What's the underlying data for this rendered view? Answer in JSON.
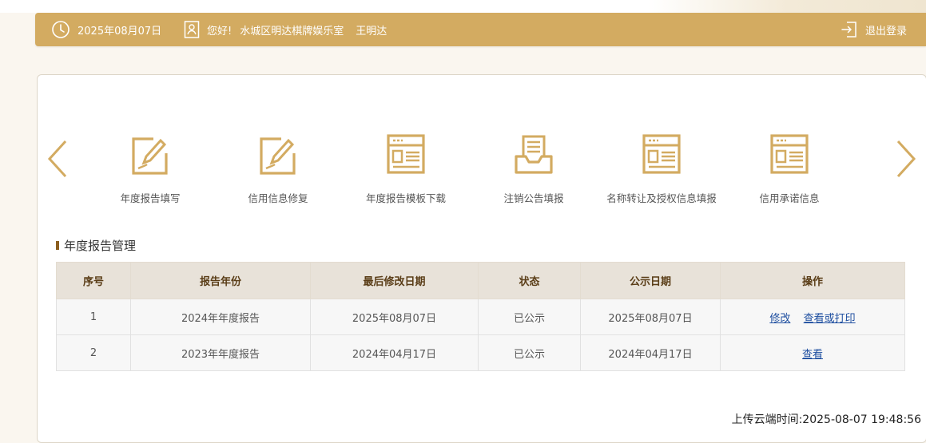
{
  "header": {
    "date": "2025年08月07日",
    "greeting": "您好!",
    "org_name": "水城区明达棋牌娱乐室",
    "user_name": "王明达",
    "logout_label": "退出登录"
  },
  "nav": {
    "items": [
      {
        "label": "年度报告填写",
        "icon": "edit-form-icon"
      },
      {
        "label": "信用信息修复",
        "icon": "edit-form-icon"
      },
      {
        "label": "年度报告模板下载",
        "icon": "document-template-icon"
      },
      {
        "label": "注销公告填报",
        "icon": "inbox-document-icon"
      },
      {
        "label": "名称转让及授权信息填报",
        "icon": "document-template-icon"
      },
      {
        "label": "信用承诺信息",
        "icon": "document-template-icon"
      }
    ]
  },
  "section": {
    "title": "年度报告管理"
  },
  "table": {
    "headers": [
      "序号",
      "报告年份",
      "最后修改日期",
      "状态",
      "公示日期",
      "操作"
    ],
    "rows": [
      {
        "index": "1",
        "year": "2024年年度报告",
        "modified": "2025年08月07日",
        "status": "已公示",
        "published": "2025年08月07日",
        "actions": [
          "修改",
          "查看或打印"
        ]
      },
      {
        "index": "2",
        "year": "2023年年度报告",
        "modified": "2024年04月17日",
        "status": "已公示",
        "published": "2024年04月17日",
        "actions": [
          "查看"
        ]
      }
    ]
  },
  "footer": {
    "upload_time": "上传云端时间:2025-08-07 19:48:56"
  },
  "colors": {
    "accent": "#d3ab61",
    "header_text": "#ffffff",
    "table_header_bg": "#e8e2d9",
    "link": "#1f4fa0"
  }
}
